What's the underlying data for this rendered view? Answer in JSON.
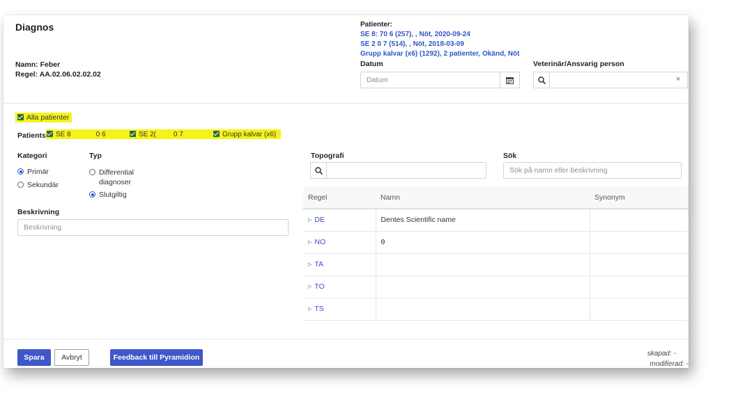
{
  "header": {
    "title": "Diagnos",
    "name_line": "Namn: Feber",
    "rule_line": "Regel: AA.02.06.02.02.02"
  },
  "patients_panel": {
    "label": "Patienter:",
    "items": [
      "SE 8:         70 6 (257),         , Nöt, 2020-09-24",
      "SE 2          0 7 (514),          , Nöt, 2018-03-09",
      "Grupp kalvar (x6) (1292), 2 patienter, Okänd, Nöt"
    ]
  },
  "datum": {
    "label": "Datum",
    "placeholder": "Datum"
  },
  "vet": {
    "label": "Veterinär/Ansvarig person",
    "value": "",
    "clear": "×"
  },
  "all_patients": {
    "label": "Alla patienter",
    "checked": true
  },
  "patient_checks": {
    "label": "Patients",
    "items": [
      "SE 8             0 6",
      "SE 2(         0 7",
      "Grupp kalvar (x6)"
    ]
  },
  "kategori": {
    "label": "Kategori",
    "options": [
      "Primär",
      "Sekundär"
    ],
    "selected": "Primär"
  },
  "typ": {
    "label": "Typ",
    "options": [
      "Differential diagnoser",
      "Slutgiltig"
    ],
    "selected": "Slutgiltig"
  },
  "beskrivning": {
    "label": "Beskrivning",
    "placeholder": "Beskrivning"
  },
  "topografi": {
    "label": "Topografi",
    "value": ""
  },
  "sok": {
    "label": "Sök",
    "placeholder": "Sök på namn eller beskrivning"
  },
  "rules_table": {
    "columns": [
      "Regel",
      "Namn",
      "Synonym"
    ],
    "rows": [
      {
        "code": "DE",
        "name": "Dentes Scientific name",
        "synonym": ""
      },
      {
        "code": "NO",
        "name": "0",
        "synonym": ""
      },
      {
        "code": "TA",
        "name": "",
        "synonym": ""
      },
      {
        "code": "TO",
        "name": "",
        "synonym": ""
      },
      {
        "code": "TS",
        "name": "",
        "synonym": ""
      }
    ]
  },
  "footer": {
    "save": "Spara",
    "cancel": "Avbryt",
    "feedback": "Feedback till Pyramidion",
    "created": "skapad: -",
    "modified": "modifierad: -"
  },
  "colors": {
    "primary": "#3e57c9",
    "link": "#2f55c8",
    "highlight": "#f6f31a",
    "checkbox": "#2d6a2f"
  }
}
